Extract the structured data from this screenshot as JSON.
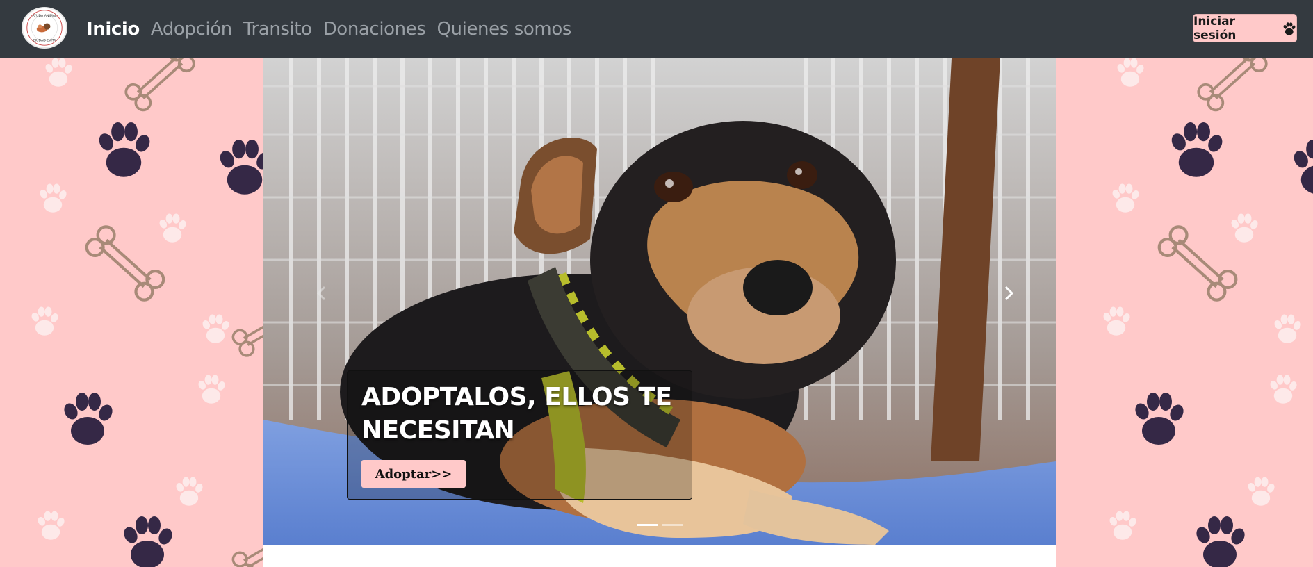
{
  "logo": {
    "top_text": "AYUDA ANIMAL",
    "bottom_text": "CIUDAD EVITA"
  },
  "nav": {
    "items": [
      {
        "label": "Inicio",
        "active": true
      },
      {
        "label": "Adopción"
      },
      {
        "label": "Transito"
      },
      {
        "label": "Donaciones"
      },
      {
        "label": "Quienes somos"
      }
    ],
    "login_label": "Iniciar sesión",
    "login_icon": "paw-icon"
  },
  "hero": {
    "caption_title": "ADOPTALOS, ELLOS TE NECESITAN",
    "button_label": "Adoptar>>",
    "prev_icon": "chevron-left-icon",
    "next_icon": "chevron-right-icon",
    "slide_count": 2,
    "active_slide": 0
  },
  "colors": {
    "navbar": "#343a40",
    "pink": "#ffc9c9",
    "paw_dark": "#352846",
    "paw_light": "#fde9e9",
    "bone": "#a88a78"
  }
}
